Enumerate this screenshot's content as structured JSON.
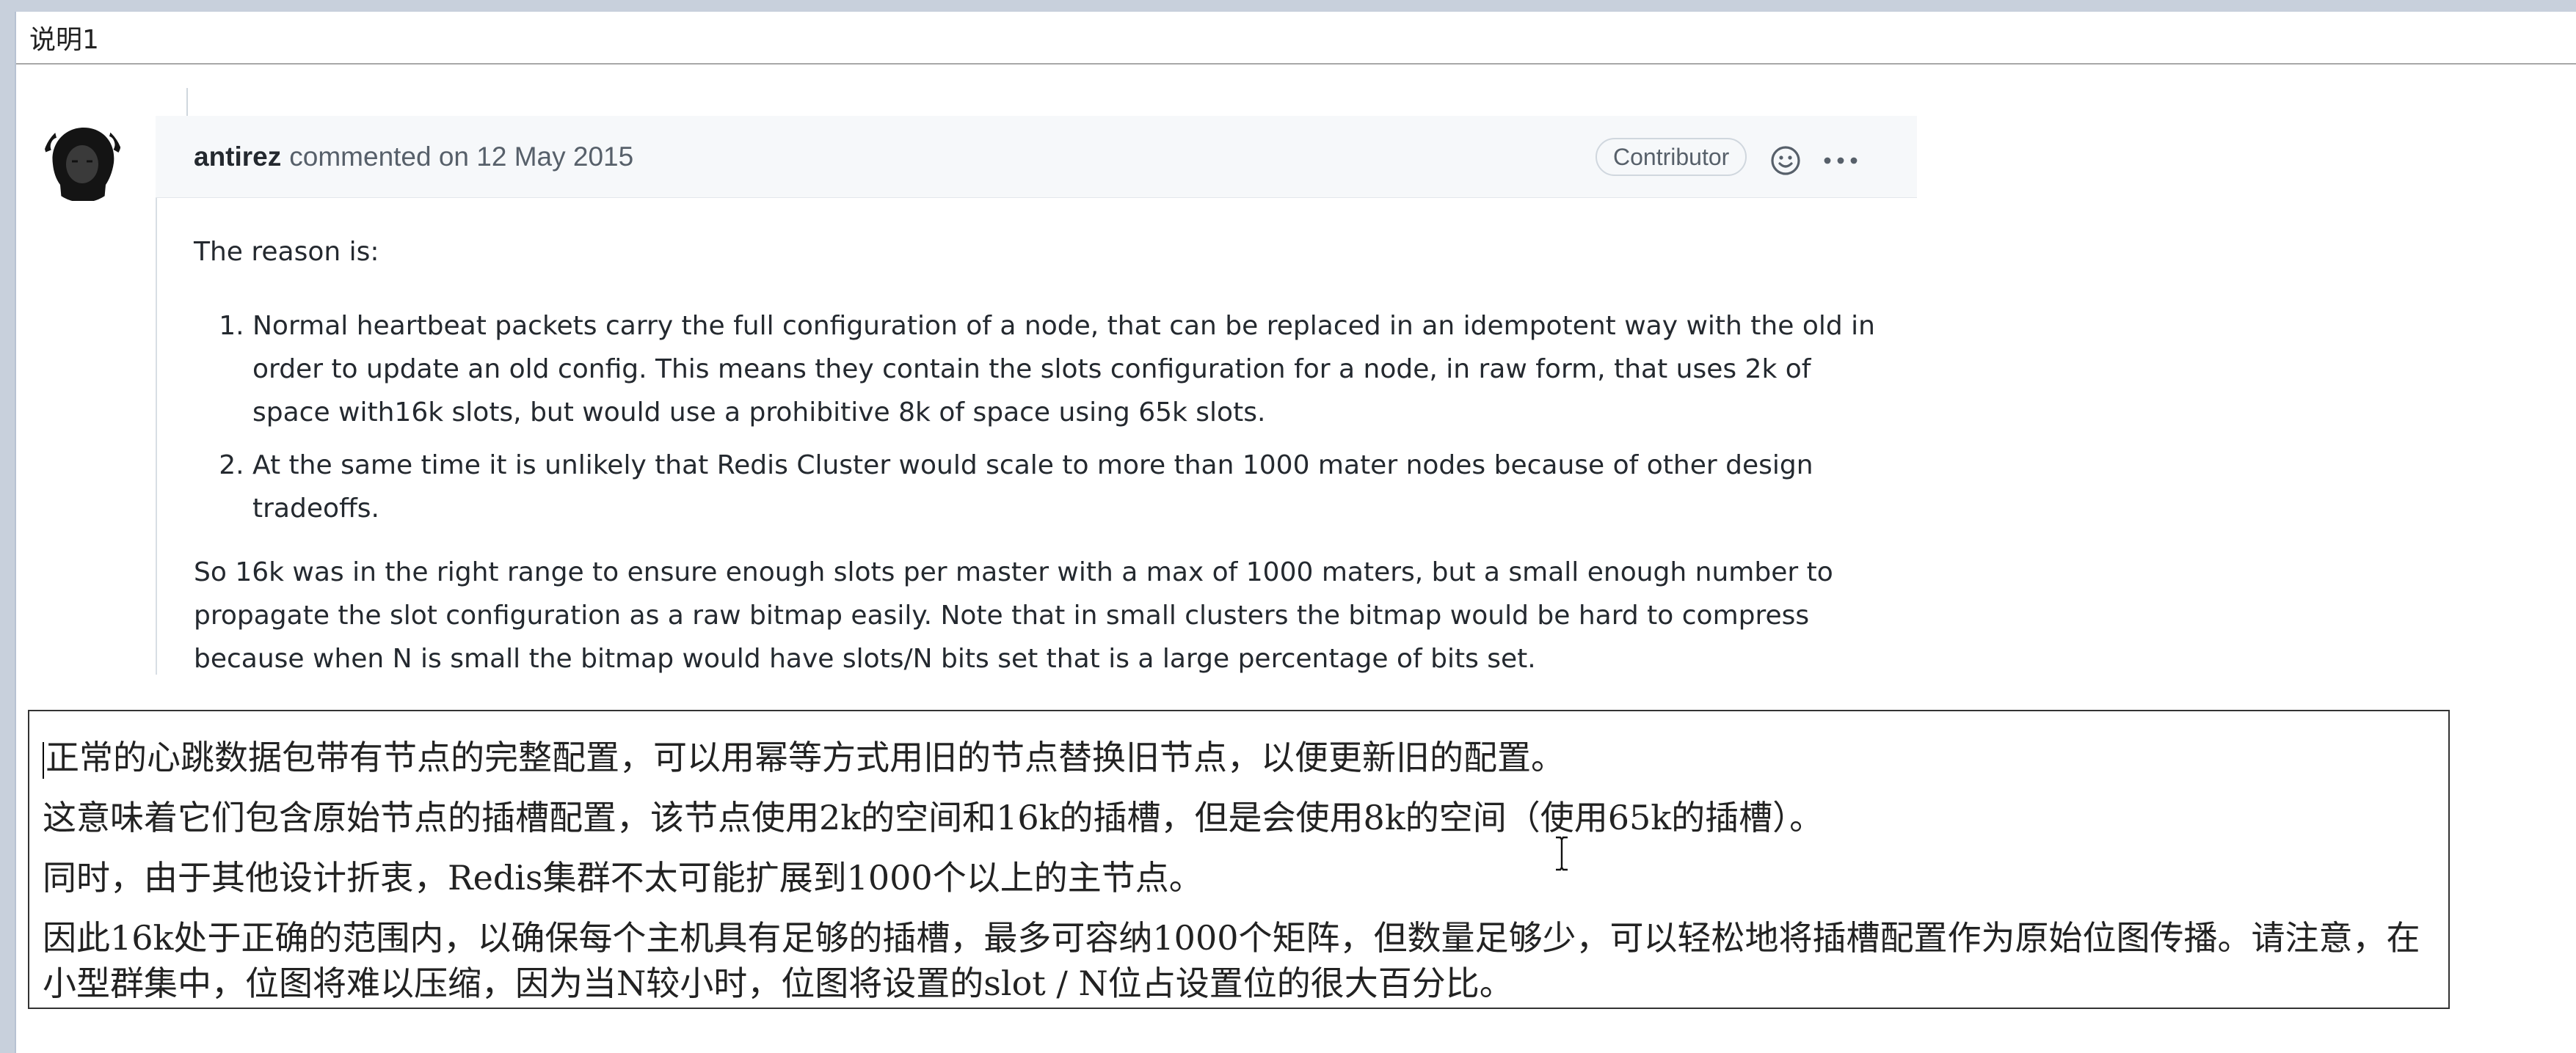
{
  "window": {
    "title": "说明1"
  },
  "comment": {
    "author": "antirez",
    "meta": "commented on 12 May 2015",
    "badge": "Contributor",
    "icons": {
      "avatar": "avatar-photo",
      "reaction": "smiley-icon",
      "more": "kebab-menu-icon"
    },
    "intro": "The reason is:",
    "list": [
      "Normal heartbeat packets carry the full configuration of a node, that can be replaced in an idempotent way with the old in order to update an old config. This means they contain the slots configuration for a node, in raw form, that uses 2k of space with16k slots, but would use a prohibitive 8k of space using 65k slots.",
      "At the same time it is unlikely that Redis Cluster would scale to more than 1000 mater nodes because of other design tradeoffs."
    ],
    "conclusion": "So 16k was in the right range to ensure enough slots per master with a max of 1000 maters, but a small enough number to propagate the slot configuration as a raw bitmap easily. Note that in small clusters the bitmap would be hard to compress because when N is small the bitmap would have slots/N bits set that is a large percentage of bits set."
  },
  "translation": {
    "lines": [
      "正常的心跳数据包带有节点的完整配置，可以用幂等方式用旧的节点替换旧节点，以便更新旧的配置。",
      "这意味着它们包含原始节点的插槽配置，该节点使用2k的空间和16k的插槽，但是会使用8k的空间（使用65k的插槽）。",
      "同时，由于其他设计折衷，Redis集群不太可能扩展到1000个以上的主节点。"
    ],
    "paragraph": "因此16k处于正确的范围内，以确保每个主机具有足够的插槽，最多可容纳1000个矩阵，但数量足够少，可以轻松地将插槽配置作为原始位图传播。请注意，在小型群集中，位图将难以压缩，因为当N较小时，位图将设置的slot / N位占设置位的很大百分比。"
  }
}
